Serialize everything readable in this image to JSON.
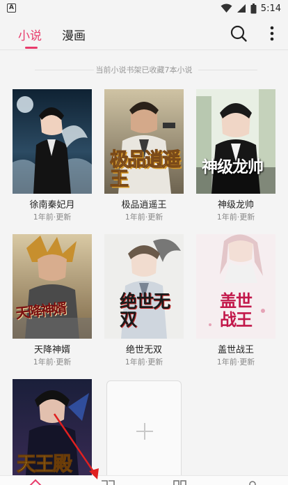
{
  "status_bar": {
    "time": "5:14",
    "left_icon_letter": "A",
    "icons": [
      "wifi-icon",
      "signal-icon",
      "battery-icon"
    ]
  },
  "header": {
    "tabs": [
      {
        "label": "小说",
        "active": true
      },
      {
        "label": "漫画",
        "active": false
      }
    ],
    "accent_color": "#e83b6b",
    "actions": [
      "search-icon",
      "more-icon"
    ]
  },
  "shelf": {
    "summary": "当前小说书架已收藏7本小说",
    "books": [
      {
        "title": "徐南秦妃月",
        "meta": "1年前·更新",
        "cover_text": ""
      },
      {
        "title": "极品逍遥王",
        "meta": "1年前·更新",
        "cover_text": "极品逍遥王"
      },
      {
        "title": "神级龙帅",
        "meta": "1年前·更新",
        "cover_text": "神级龙帅"
      },
      {
        "title": "天降神婿",
        "meta": "1年前·更新",
        "cover_text": "天降神婿"
      },
      {
        "title": "绝世无双",
        "meta": "1年前·更新",
        "cover_text": "绝世无双"
      },
      {
        "title": "盖世战王",
        "meta": "1年前·更新",
        "cover_text": "盖世战王"
      },
      {
        "title": "",
        "meta": "",
        "cover_text": "天王殿"
      }
    ],
    "add_icon": "plus-icon"
  },
  "bottom_nav": {
    "items": [
      "home-icon",
      "bookshelf-icon",
      "category-icon",
      "profile-icon"
    ]
  },
  "annotation": {
    "arrow_color": "#e02020"
  }
}
